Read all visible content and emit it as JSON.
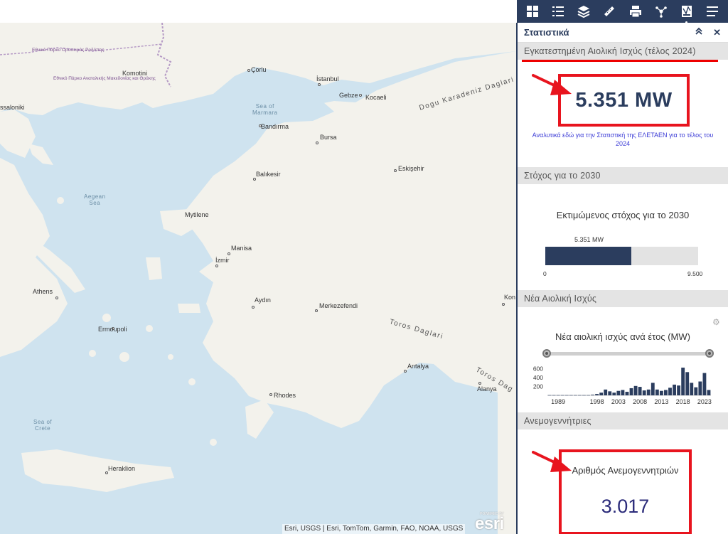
{
  "map": {
    "places": [
      {
        "id": "corlu",
        "label": "Çorlu"
      },
      {
        "id": "istanbul",
        "label": "İstanbul"
      },
      {
        "id": "gebze",
        "label": "Gebze"
      },
      {
        "id": "kocaeli",
        "label": "Kocaeli"
      },
      {
        "id": "thessaloniki",
        "label": "ssaloniki"
      },
      {
        "id": "komotini",
        "label": "Komotini"
      },
      {
        "id": "bandirma",
        "label": "Bandırma"
      },
      {
        "id": "bursa",
        "label": "Bursa"
      },
      {
        "id": "eskisehir",
        "label": "Eskişehir"
      },
      {
        "id": "balikesir",
        "label": "Balıkesir"
      },
      {
        "id": "mytilene",
        "label": "Mytilene"
      },
      {
        "id": "manisa",
        "label": "Manisa"
      },
      {
        "id": "izmir",
        "label": "İzmir"
      },
      {
        "id": "athens",
        "label": "Athens"
      },
      {
        "id": "aydin",
        "label": "Aydın"
      },
      {
        "id": "merkezefendi",
        "label": "Merkezefendi"
      },
      {
        "id": "ermoupoli",
        "label": "Ermoupoli"
      },
      {
        "id": "antalya",
        "label": "Antalya"
      },
      {
        "id": "alanya",
        "label": "Alanya"
      },
      {
        "id": "rhodes",
        "label": "Rhodes"
      },
      {
        "id": "heraklion",
        "label": "Heraklion"
      },
      {
        "id": "kon",
        "label": "Kon"
      }
    ],
    "water": [
      {
        "id": "marmara",
        "label": "Sea of\nMarmara"
      },
      {
        "id": "aegean",
        "label": "Aegean\nSea"
      },
      {
        "id": "crete",
        "label": "Sea of\nCrete"
      }
    ],
    "ranges": [
      {
        "id": "karadeniz",
        "label": "Dogu Karadeniz Daglari"
      },
      {
        "id": "toros1",
        "label": "Toros Daglari"
      },
      {
        "id": "toros2",
        "label": "Toros Dag"
      }
    ],
    "parks": [
      {
        "id": "park1",
        "label": "Εθνικό Πάρκο\nΟροσειράς\nΡοδόπης"
      },
      {
        "id": "park2",
        "label": "Εθνικό Πάρκο\nΑνατολικής\nΜακεδονίας και\nΘράκης"
      }
    ],
    "attribution": "Esri, USGS | Esri, TomTom, Garmin, FAO, NOAA, USGS",
    "logo": "esri",
    "logo_caption": "POWERED BY"
  },
  "toolbar": {
    "tools": [
      {
        "name": "grid-icon"
      },
      {
        "name": "list-icon"
      },
      {
        "name": "layers-icon"
      },
      {
        "name": "ruler-icon"
      },
      {
        "name": "print-icon"
      },
      {
        "name": "share-icon"
      },
      {
        "name": "stats-icon",
        "active": true
      },
      {
        "name": "menu-icon"
      }
    ]
  },
  "panel": {
    "title": "Στατιστικά",
    "collapse_glyph": "≈",
    "close_glyph": "✕",
    "sections": {
      "installed": {
        "title": "Εγκατεστημένη Αιολική Ισχύς (τέλος 2024)",
        "value": "5.351 MW",
        "link": "Αναλυτικά εδώ για την Στατιστική της ΕΛΕΤΑΕΝ για το τέλος του 2024"
      },
      "target": {
        "title": "Στόχος για το 2030",
        "subtitle": "Εκτιμώμενος στόχος για το 2030",
        "current_label": "5.351 MW",
        "current": 5351,
        "max": 9500,
        "min_label": "0",
        "max_label": "9.500"
      },
      "new": {
        "title": "Νέα Αιολική Ισχύς",
        "gear_glyph": "⚙",
        "chart_title": "Νέα αιολική ισχύς ανά έτος (MW)"
      },
      "turbines": {
        "title": "Ανεμογεννήτριες",
        "label": "Αριθμός Ανεμογεννητριών",
        "value": "3.017"
      }
    }
  },
  "chart_data": {
    "type": "bar",
    "title": "Νέα αιολική ισχύς ανά έτος (MW)",
    "x": [
      1987,
      1988,
      1989,
      1990,
      1991,
      1992,
      1993,
      1994,
      1995,
      1996,
      1997,
      1998,
      1999,
      2000,
      2001,
      2002,
      2003,
      2004,
      2005,
      2006,
      2007,
      2008,
      2009,
      2010,
      2011,
      2012,
      2013,
      2014,
      2015,
      2016,
      2017,
      2018,
      2019,
      2020,
      2021,
      2022,
      2023,
      2024
    ],
    "values": [
      5,
      5,
      5,
      5,
      5,
      5,
      5,
      5,
      5,
      5,
      15,
      30,
      60,
      130,
      90,
      60,
      100,
      120,
      80,
      160,
      210,
      190,
      110,
      130,
      280,
      130,
      100,
      120,
      170,
      240,
      220,
      620,
      520,
      280,
      180,
      310,
      500,
      120
    ],
    "xticks": [
      "1989",
      "1998",
      "2003",
      "2008",
      "2013",
      "2018",
      "2023"
    ],
    "yticks": [
      "600",
      "400",
      "200"
    ],
    "ylim": [
      0,
      700
    ]
  }
}
